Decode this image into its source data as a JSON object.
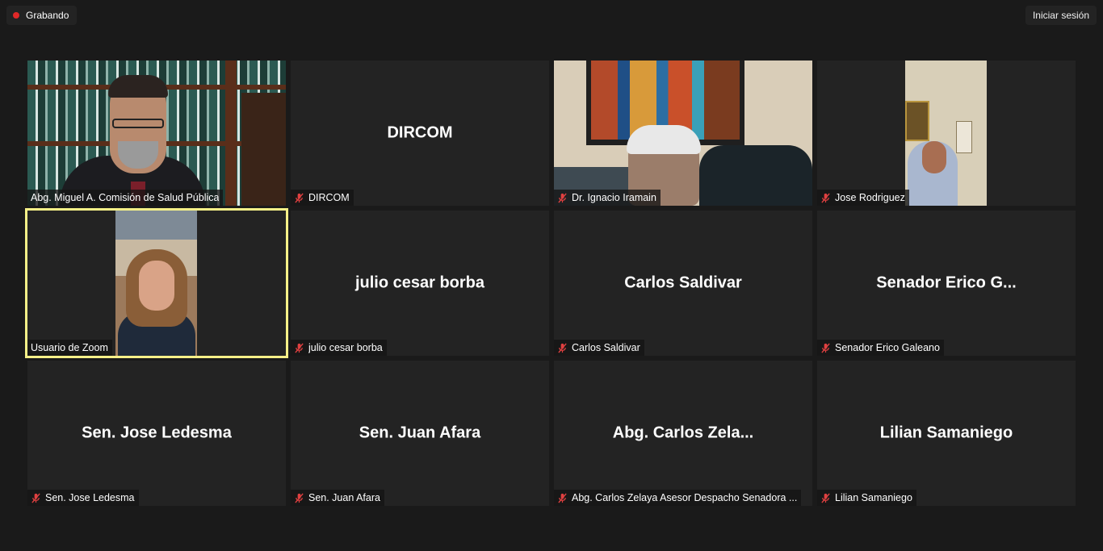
{
  "top_bar": {
    "recording_label": "Grabando",
    "signin_label": "Iniciar sesión"
  },
  "colors": {
    "background": "#1a1a1a",
    "tile": "#232323",
    "active_speaker_border": "#f5f088",
    "recording_dot": "#e02828",
    "mute_icon": "#e04040"
  },
  "participants": [
    {
      "label": "Abg. Miguel A. Comisión de Salud Pública",
      "display": "",
      "muted": false,
      "video": true
    },
    {
      "label": "DIRCOM",
      "display": "DIRCOM",
      "muted": true,
      "video": false
    },
    {
      "label": "Dr. Ignacio Iramain",
      "display": "",
      "muted": true,
      "video": true
    },
    {
      "label": "Jose Rodriguez",
      "display": "",
      "muted": true,
      "video": true
    },
    {
      "label": "Usuario de Zoom",
      "display": "",
      "muted": false,
      "video": true,
      "active": true
    },
    {
      "label": "julio cesar borba",
      "display": "julio cesar borba",
      "muted": true,
      "video": false
    },
    {
      "label": "Carlos Saldivar",
      "display": "Carlos Saldivar",
      "muted": true,
      "video": false
    },
    {
      "label": "Senador Erico Galeano",
      "display": "Senador Erico G...",
      "muted": true,
      "video": false
    },
    {
      "label": "Sen. Jose Ledesma",
      "display": "Sen. Jose Ledesma",
      "muted": true,
      "video": false
    },
    {
      "label": "Sen. Juan Afara",
      "display": "Sen. Juan Afara",
      "muted": true,
      "video": false
    },
    {
      "label": "Abg. Carlos Zelaya Asesor Despacho Senadora ...",
      "display": "Abg. Carlos Zela...",
      "muted": true,
      "video": false
    },
    {
      "label": "Lilian Samaniego",
      "display": "Lilian Samaniego",
      "muted": true,
      "video": false
    }
  ]
}
